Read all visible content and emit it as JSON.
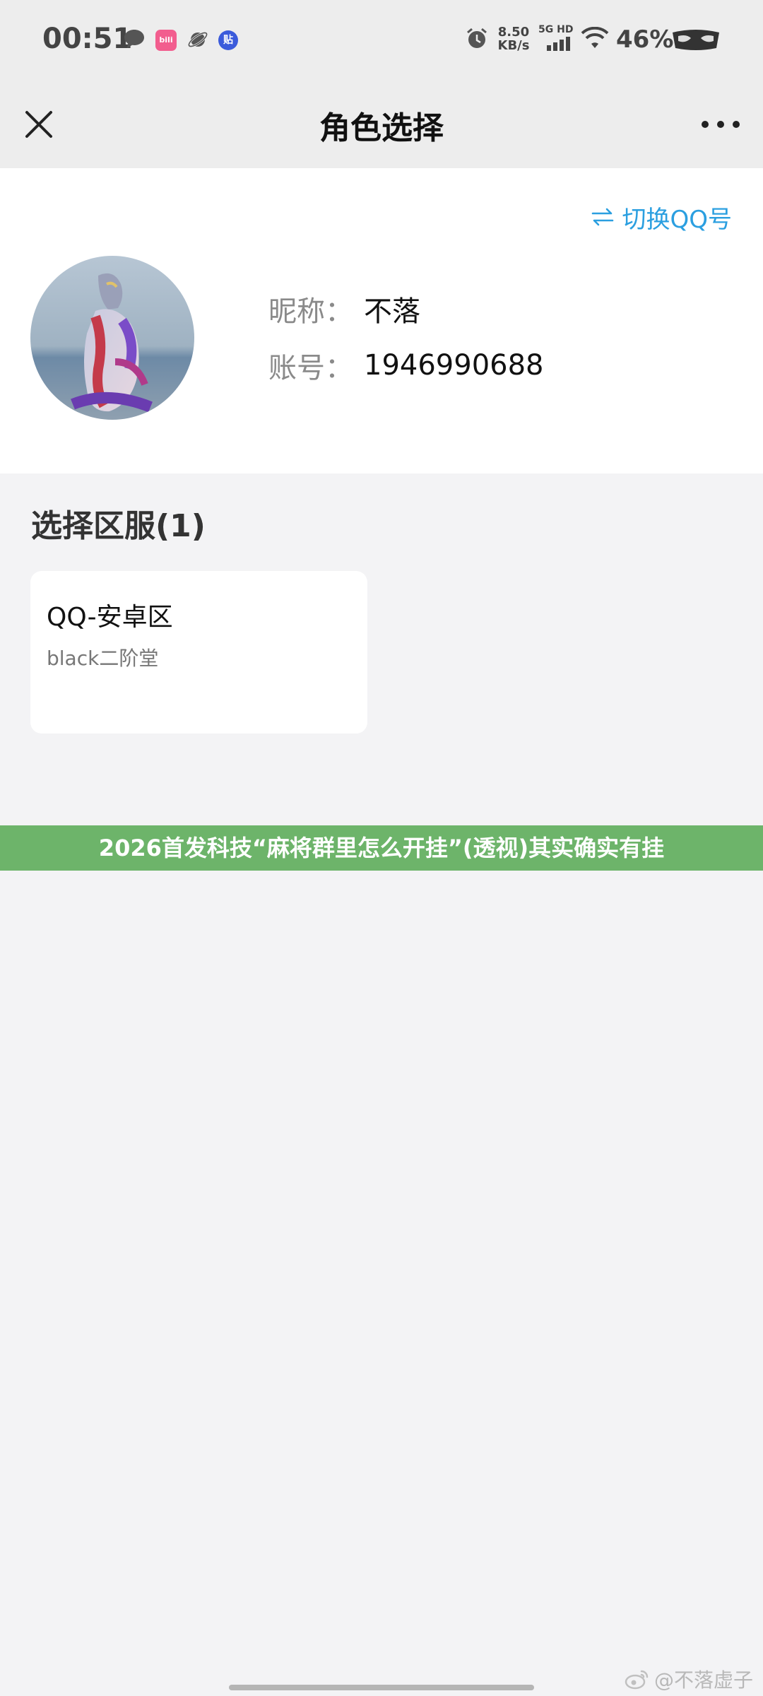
{
  "status_bar": {
    "time": "00:51",
    "app1_badge": "bili",
    "app3_badge": "贴",
    "net_speed_value": "8.50",
    "net_speed_unit": "KB/s",
    "network": "5G HD",
    "battery": "46%"
  },
  "nav": {
    "title": "角色选择"
  },
  "account": {
    "switch_label": "切换QQ号",
    "nickname_label": "昵称：",
    "nickname": "不落",
    "account_label": "账号：",
    "account_number": "1946990688"
  },
  "servers": {
    "section_title": "选择区服(1)",
    "items": [
      {
        "name": "QQ-安卓区",
        "role": "black二阶堂"
      }
    ]
  },
  "banner": {
    "text": "2026首发科技“麻将群里怎么开挂”(透视)其实确实有挂"
  },
  "watermark": {
    "text": "@不落虚子"
  },
  "colors": {
    "accent": "#2b9fe0",
    "banner_bg": "#6db46a",
    "page_bg": "#f3f3f5",
    "bar_bg": "#ededed"
  }
}
